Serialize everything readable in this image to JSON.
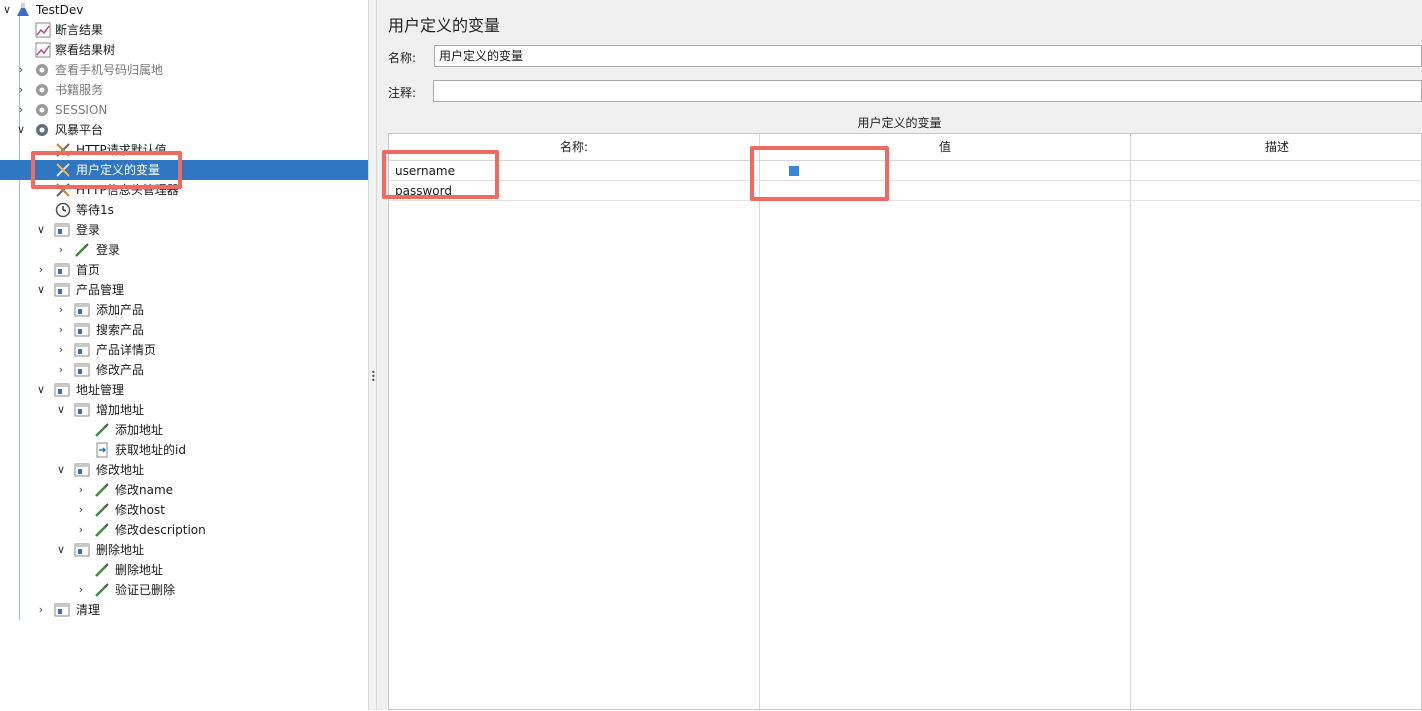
{
  "tree": {
    "root": {
      "label": "TestDev",
      "icon": "flask-icon"
    },
    "nodes": [
      {
        "label": "断言结果",
        "icon": "chart-icon"
      },
      {
        "label": "察看结果树",
        "icon": "chart-icon"
      },
      {
        "label": "查看手机号码归属地",
        "icon": "gear-icon",
        "disabled": true
      },
      {
        "label": "书籍服务",
        "icon": "gear-icon",
        "disabled": true
      },
      {
        "label": "SESSION",
        "icon": "gear-icon",
        "disabled": true
      },
      {
        "label": "风暴平台",
        "icon": "gear-icon"
      },
      {
        "label": "HTTP请求默认值",
        "icon": "wrench-icon"
      },
      {
        "label": "用户定义的变量",
        "icon": "wrench-icon"
      },
      {
        "label": "HTTP信息头管理器",
        "icon": "wrench-icon"
      },
      {
        "label": "等待1s",
        "icon": "timer-icon"
      },
      {
        "label": "登录",
        "icon": "controller-icon"
      },
      {
        "label": "登录",
        "icon": "pipette-icon"
      },
      {
        "label": "首页",
        "icon": "controller-icon"
      },
      {
        "label": "产品管理",
        "icon": "controller-icon"
      },
      {
        "label": "添加产品",
        "icon": "controller-icon"
      },
      {
        "label": "搜索产品",
        "icon": "controller-icon"
      },
      {
        "label": "产品详情页",
        "icon": "controller-icon"
      },
      {
        "label": "修改产品",
        "icon": "controller-icon"
      },
      {
        "label": "地址管理",
        "icon": "controller-icon"
      },
      {
        "label": "增加地址",
        "icon": "controller-icon"
      },
      {
        "label": "添加地址",
        "icon": "pipette-icon"
      },
      {
        "label": "获取地址的id",
        "icon": "extractor-icon"
      },
      {
        "label": "修改地址",
        "icon": "controller-icon"
      },
      {
        "label": "修改name",
        "icon": "pipette-icon"
      },
      {
        "label": "修改host",
        "icon": "pipette-icon"
      },
      {
        "label": "修改description",
        "icon": "pipette-icon"
      },
      {
        "label": "删除地址",
        "icon": "controller-icon"
      },
      {
        "label": "删除地址",
        "icon": "pipette-icon"
      },
      {
        "label": "验证已删除",
        "icon": "pipette-icon"
      },
      {
        "label": "清理",
        "icon": "controller-icon"
      }
    ]
  },
  "panel": {
    "title": "用户定义的变量",
    "name_label": "名称:",
    "name_value": "用户定义的变量",
    "comment_label": "注释:",
    "comment_value": "",
    "table_caption": "用户定义的变量",
    "columns": [
      "名称:",
      "值",
      "描述"
    ],
    "rows": [
      {
        "name": "username",
        "value": "",
        "description": ""
      },
      {
        "name": "password",
        "value": "",
        "description": ""
      }
    ]
  },
  "colors": {
    "selection": "#2f76c3",
    "highlight": "#ef6a61",
    "panel_bg": "#f0f0f0"
  }
}
